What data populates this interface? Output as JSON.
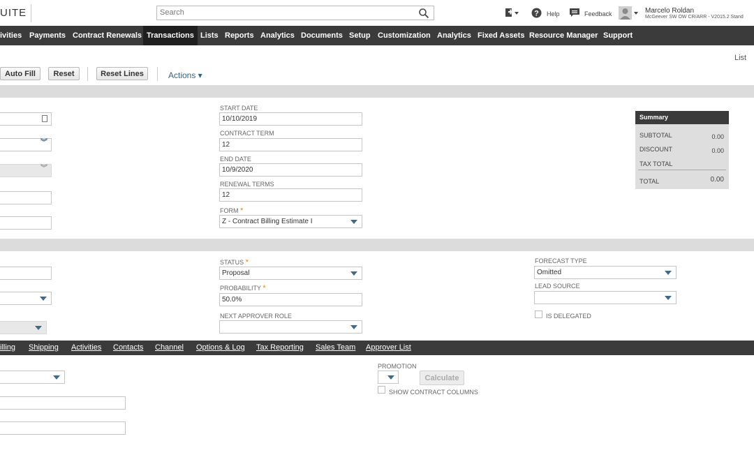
{
  "header": {
    "logo_text": "UITE",
    "search_placeholder": "Search",
    "help_label": "Help",
    "feedback_label": "Feedback",
    "user_name": "Marcelo Roldan",
    "user_account": "McGeever SW OW CR/ARR - V2015.2 Stand"
  },
  "nav": {
    "items": [
      "ivities",
      "Payments",
      "Contract Renewals",
      "Transactions",
      "Lists",
      "Reports",
      "Analytics",
      "Documents",
      "Setup",
      "Customization",
      "Analytics",
      "Fixed Assets",
      "Resource Manager",
      "Support"
    ],
    "active": "Transactions"
  },
  "toolbar": {
    "autofill_label": "Auto Fill",
    "reset_label": "Reset",
    "reset_lines_label": "Reset Lines",
    "actions_label": "Actions ▾",
    "list_label": "List"
  },
  "primary": {
    "start_date_label": "START DATE",
    "start_date_value": "10/10/2019",
    "contract_term_label": "CONTRACT TERM",
    "contract_term_value": "12",
    "end_date_label": "END DATE",
    "end_date_value": "10/9/2020",
    "renewal_terms_label": "RENEWAL TERMS",
    "renewal_terms_value": "12",
    "form_label": "FORM",
    "form_value": "Z - Contract Billing Estimate I"
  },
  "summary": {
    "title": "Summary",
    "subtotal_label": "SUBTOTAL",
    "subtotal_value": "0.00",
    "discount_label": "DISCOUNT",
    "discount_value": "0.00",
    "tax_total_label": "TAX TOTAL",
    "total_label": "TOTAL",
    "total_value": "0.00"
  },
  "secondary": {
    "status_label": "STATUS",
    "status_value": "Proposal",
    "probability_label": "PROBABILITY",
    "probability_value": "50.0%",
    "next_approver_label": "NEXT APPROVER ROLE",
    "forecast_type_label": "FORECAST TYPE",
    "forecast_type_value": "Omitted",
    "lead_source_label": "LEAD SOURCE",
    "is_delegated_label": "IS DELEGATED"
  },
  "subtabs": [
    "illing",
    "Shipping",
    "Activities",
    "Contacts",
    "Channel",
    "Options & Log",
    "Tax Reporting",
    "Sales Team",
    "Approver List"
  ],
  "items": {
    "promotion_label": "PROMOTION",
    "calculate_label": "Calculate",
    "show_contract_columns_label": "SHOW CONTRACT COLUMNS"
  },
  "colors": {
    "nav_bg": "#3b3b3b",
    "nav_active": "#1f1f1f",
    "section_bar": "#dcdcdc",
    "link_blue": "#36627f",
    "required": "#e08a00"
  }
}
